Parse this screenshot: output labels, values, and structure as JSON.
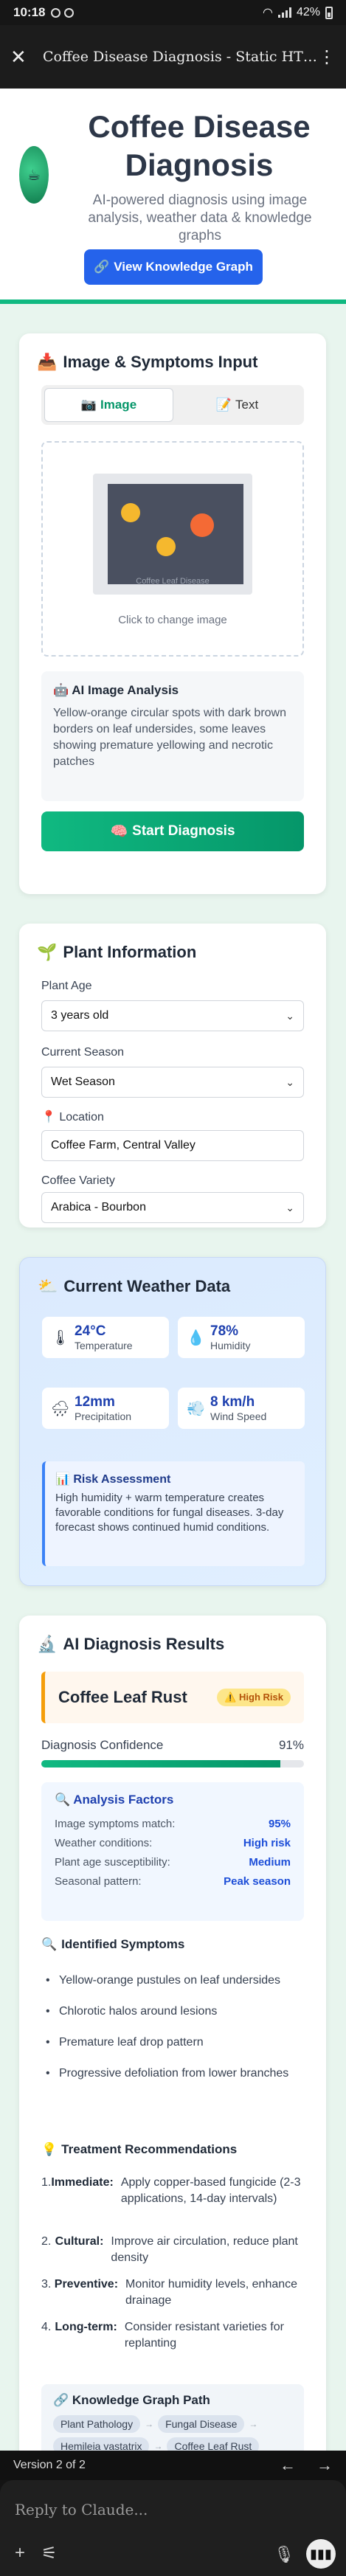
{
  "status": {
    "time": "10:18",
    "battery": "42%"
  },
  "appbar": {
    "title": "Coffee Disease Diagnosis - Static HTM..."
  },
  "hero": {
    "title": "Coffee Disease Diagnosis",
    "subtitle": "AI-powered diagnosis using image analysis, weather data & knowledge graphs",
    "kg_button": "View Knowledge Graph"
  },
  "input": {
    "heading": "Image & Symptoms Input",
    "tabs": [
      "Image",
      "Text"
    ],
    "thumb_caption": "Coffee Leaf Disease",
    "upload_hint": "Click to change image",
    "analysis_title": "AI Image Analysis",
    "analysis_text": "Yellow-orange circular spots with dark brown borders on leaf undersides, some leaves showing premature yellowing and necrotic patches",
    "diagnose_button": "Start Diagnosis"
  },
  "plant": {
    "heading": "Plant Information",
    "age_label": "Plant Age",
    "age_value": "3 years old",
    "season_label": "Current Season",
    "season_value": "Wet Season",
    "location_label": "Location",
    "location_value": "Coffee Farm, Central Valley",
    "variety_label": "Coffee Variety",
    "variety_value": "Arabica - Bourbon"
  },
  "weather": {
    "heading": "Current Weather Data",
    "tiles": [
      {
        "value": "24°C",
        "label": "Temperature"
      },
      {
        "value": "78%",
        "label": "Humidity"
      },
      {
        "value": "12mm",
        "label": "Precipitation"
      },
      {
        "value": "8 km/h",
        "label": "Wind Speed"
      }
    ],
    "risk_title": "Risk Assessment",
    "risk_text": "High humidity + warm temperature creates favorable conditions for fungal diseases. 3-day forecast shows continued humid conditions."
  },
  "results": {
    "heading": "AI Diagnosis Results",
    "disease": "Coffee Leaf Rust",
    "risk_badge": "High Risk",
    "confidence_label": "Diagnosis Confidence",
    "confidence_value": "91%",
    "confidence_fraction": 0.91,
    "factors_title": "Analysis Factors",
    "factors": [
      {
        "label": "Image symptoms match:",
        "value": "95%"
      },
      {
        "label": "Weather conditions:",
        "value": "High risk"
      },
      {
        "label": "Plant age susceptibility:",
        "value": "Medium"
      },
      {
        "label": "Seasonal pattern:",
        "value": "Peak season"
      }
    ],
    "symptoms_title": "Identified Symptoms",
    "symptoms": [
      "Yellow-orange pustules on leaf undersides",
      "Chlorotic halos around lesions",
      "Premature leaf drop pattern",
      "Progressive defoliation from lower branches"
    ],
    "treatment_title": "Treatment Recommendations",
    "treatments": [
      {
        "n": "1.",
        "key": "Immediate:",
        "text": "Apply copper-based fungicide (2-3 applications, 14-day intervals)"
      },
      {
        "n": "2.",
        "key": "Cultural:",
        "text": "Improve air circulation, reduce plant density"
      },
      {
        "n": "3.",
        "key": "Preventive:",
        "text": "Monitor humidity levels, enhance drainage"
      },
      {
        "n": "4.",
        "key": "Long-term:",
        "text": "Consider resistant varieties for replanting"
      }
    ],
    "kg_path_title": "Knowledge Graph Path",
    "kg_path": [
      "Plant Pathology",
      "Fungal Disease",
      "Hemileia vastatrix",
      "Coffee Leaf Rust"
    ]
  },
  "footer": {
    "version": "Version 2 of 2",
    "reply_placeholder": "Reply to Claude..."
  }
}
